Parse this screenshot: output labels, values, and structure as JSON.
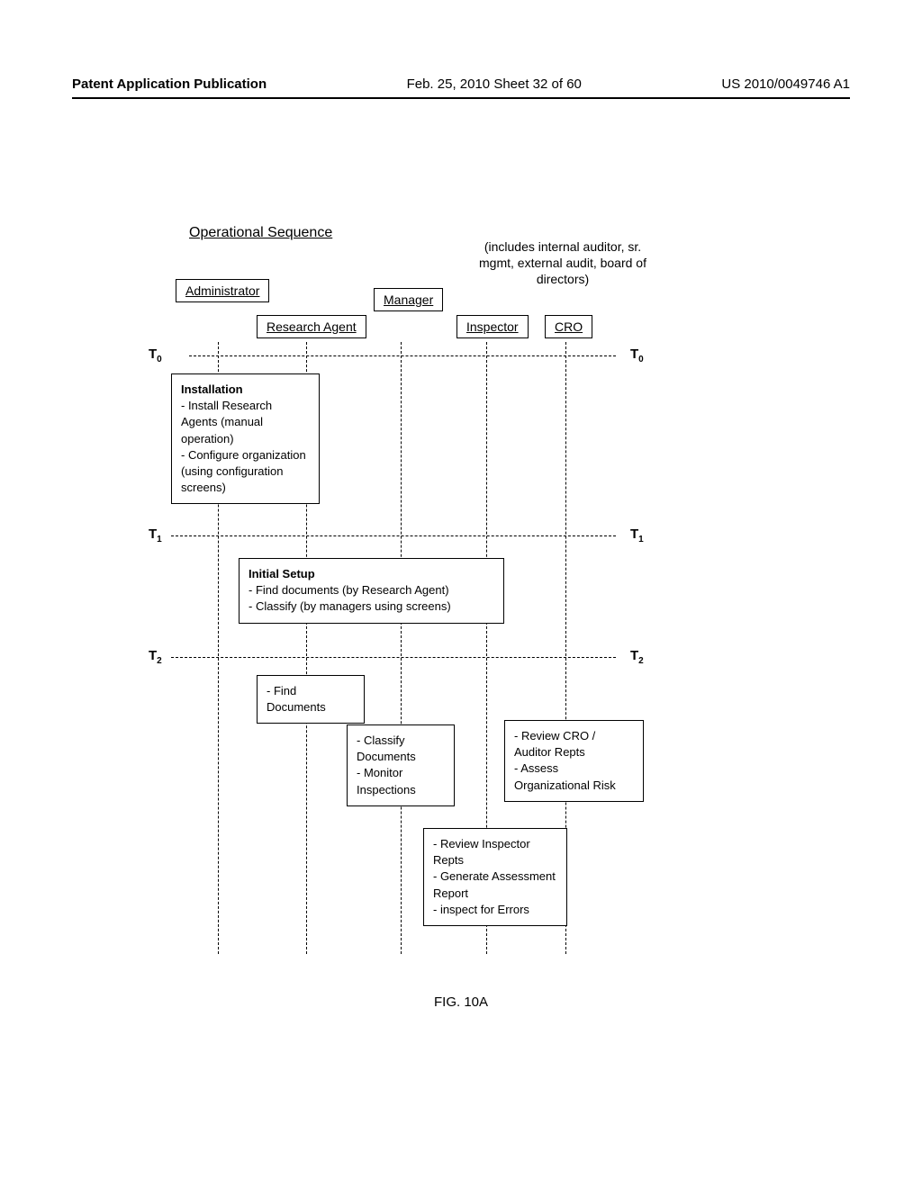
{
  "header": {
    "left": "Patent Application Publication",
    "center": "Feb. 25, 2010  Sheet 32 of 60",
    "right": "US 2010/0049746 A1"
  },
  "title": "Operational Sequence",
  "cro_note": "(includes internal auditor, sr. mgmt, external audit, board of directors)",
  "roles": {
    "admin": "Administrator",
    "research_agent": "Research Agent",
    "manager": "Manager",
    "inspector": "Inspector",
    "cro": "CRO"
  },
  "times": {
    "t0": "T",
    "t0_sub": "0",
    "t1": "T",
    "t1_sub": "1",
    "t2": "T",
    "t2_sub": "2"
  },
  "boxes": {
    "installation": {
      "title": "Installation",
      "l1": "- Install Research Agents (manual operation)",
      "l2": "- Configure organization (using configuration screens)"
    },
    "initial_setup": {
      "title": "Initial Setup",
      "l1": "- Find documents (by Research Agent)",
      "l2": "- Classify (by managers using screens)"
    },
    "find_docs": {
      "l1": "- Find Documents"
    },
    "classify": {
      "l1": "- Classify Documents",
      "l2": "- Monitor Inspections"
    },
    "review_cro": {
      "l1": "- Review CRO / Auditor Repts",
      "l2": "- Assess Organizational Risk"
    },
    "review_inspector": {
      "l1": "- Review Inspector Repts",
      "l2": "- Generate Assessment Report",
      "l3": "- inspect for Errors"
    }
  },
  "figure_label": "FIG. 10A"
}
